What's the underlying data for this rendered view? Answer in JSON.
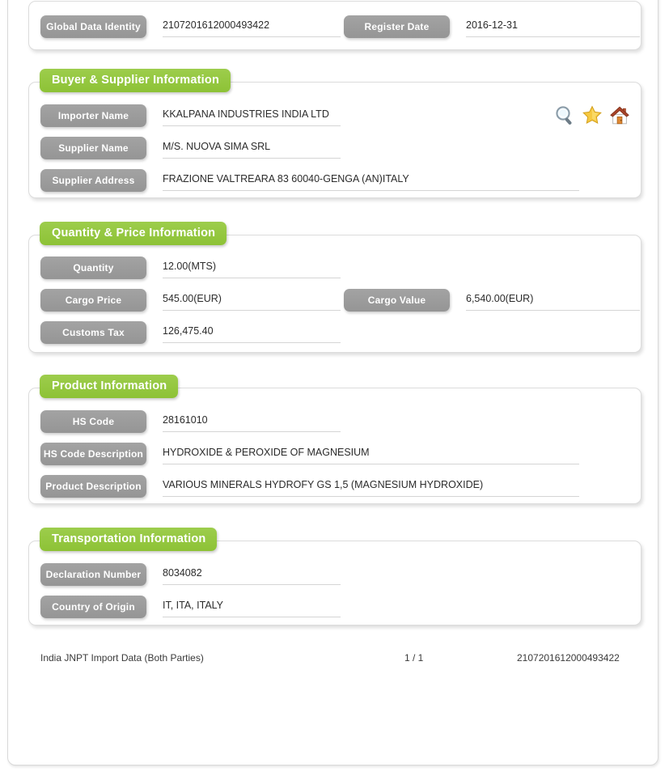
{
  "record": {
    "header": {
      "fields": [
        {
          "label": "Global Data Identity",
          "value": "2107201612000493422"
        },
        {
          "label": "Register Date",
          "value": "2016-12-31"
        }
      ]
    },
    "sections": [
      {
        "title": "Buyer & Supplier Information",
        "fields": [
          {
            "label": "Importer Name",
            "value": "KKALPANA INDUSTRIES INDIA LTD"
          },
          {
            "label": "Supplier Name",
            "value": "M/S. NUOVA SIMA SRL"
          },
          {
            "label": "Supplier Address",
            "value": "FRAZIONE VALTREARA 83 60040-GENGA (AN)ITALY"
          }
        ],
        "actions": [
          {
            "icon": "search-icon",
            "title": "Search"
          },
          {
            "icon": "star-icon",
            "title": "Favorite"
          },
          {
            "icon": "home-icon",
            "title": "Home"
          }
        ]
      },
      {
        "title": "Quantity & Price Information",
        "fields": [
          {
            "label": "Quantity",
            "value": "12.00(MTS)"
          },
          {
            "label": "Cargo Price",
            "value": "545.00(EUR)"
          },
          {
            "label": "Cargo Value",
            "value": "6,540.00(EUR)"
          },
          {
            "label": "Customs Tax",
            "value": "126,475.40"
          }
        ]
      },
      {
        "title": "Product Information",
        "fields": [
          {
            "label": "HS Code",
            "value": "28161010"
          },
          {
            "label": "HS Code Description",
            "value": "HYDROXIDE & PEROXIDE OF MAGNESIUM"
          },
          {
            "label": "Product Description",
            "value": "VARIOUS MINERALS HYDROFY GS 1,5 (MAGNESIUM HYDROXIDE)"
          }
        ]
      },
      {
        "title": "Transportation Information",
        "fields": [
          {
            "label": "Declaration Number",
            "value": "8034082"
          },
          {
            "label": "Country of Origin",
            "value": "IT, ITA, ITALY"
          }
        ]
      }
    ],
    "footer": {
      "source": "India JNPT Import Data (Both Parties)",
      "page": "1 / 1",
      "identity": "2107201612000493422"
    },
    "colors": {
      "accent_green": "#93c83d",
      "label_gray": "#9b9b9b",
      "text": "#2b2b2b",
      "underline": "#d5d5d5",
      "panel_border": "#dcdcdc"
    }
  }
}
